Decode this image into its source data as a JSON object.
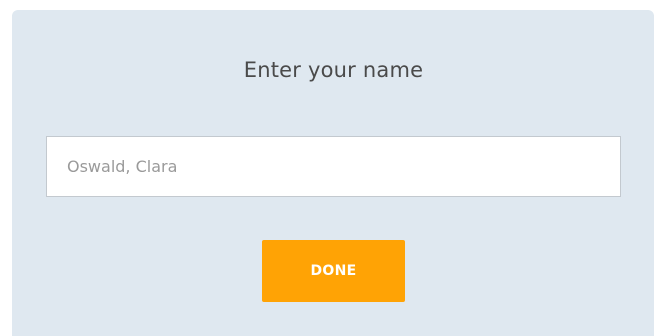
{
  "form": {
    "title": "Enter your name",
    "name_input": {
      "value": "",
      "placeholder": "Oswald, Clara"
    },
    "done_label": "DONE"
  },
  "colors": {
    "card_background": "#dfe8f0",
    "button_background": "#ffa305",
    "button_text": "#ffffff",
    "title_text": "#4a4a4a",
    "placeholder_text": "#9a9a9a"
  }
}
